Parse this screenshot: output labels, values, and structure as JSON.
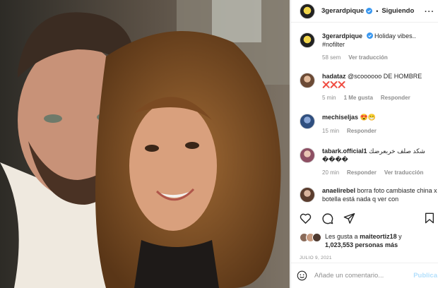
{
  "post": {
    "username": "3gerardpique",
    "follow_label": "Siguiendo",
    "more_icon": "more-horizontal-icon"
  },
  "caption": {
    "username": "3gerardpique",
    "text": "Holiday vibes..",
    "hashtag": "#nofilter",
    "time": "58 sem",
    "translate": "Ver traducción"
  },
  "comments": [
    {
      "username": "hadataz",
      "text": "@scoooooo DE HOMBRE",
      "emoji": "❌❌❌",
      "time": "5 min",
      "likes": "1 Me gusta",
      "reply": "Responder",
      "translate": ""
    },
    {
      "username": "mechiseljas",
      "text": "",
      "emoji": "😍😁",
      "time": "15 min",
      "likes": "",
      "reply": "Responder",
      "translate": ""
    },
    {
      "username": "tabark.official1",
      "text": "شكد صلف خربعرضك",
      "emoji": "",
      "second_line": "����",
      "time": "20 min",
      "likes": "",
      "reply": "Responder",
      "translate": "Ver traducción"
    },
    {
      "username": "anaelirebel",
      "text": "borra foto cambiaste china x botella está nada q ver con",
      "emoji": "",
      "time": "",
      "likes": "",
      "reply": "",
      "translate": ""
    }
  ],
  "likes": {
    "prefix": "Les gusta a",
    "user": "maiteortiz18",
    "joiner": "y",
    "count": "1,023,553 personas más"
  },
  "date": "JULIO 9, 2021",
  "comment_box": {
    "placeholder": "Añade un comentario...",
    "publish": "Publica"
  },
  "colors": {
    "accent": "#0095f6",
    "verified": "#3897f0",
    "muted": "#8e8e8e",
    "publish_disabled": "#b2dffc"
  }
}
